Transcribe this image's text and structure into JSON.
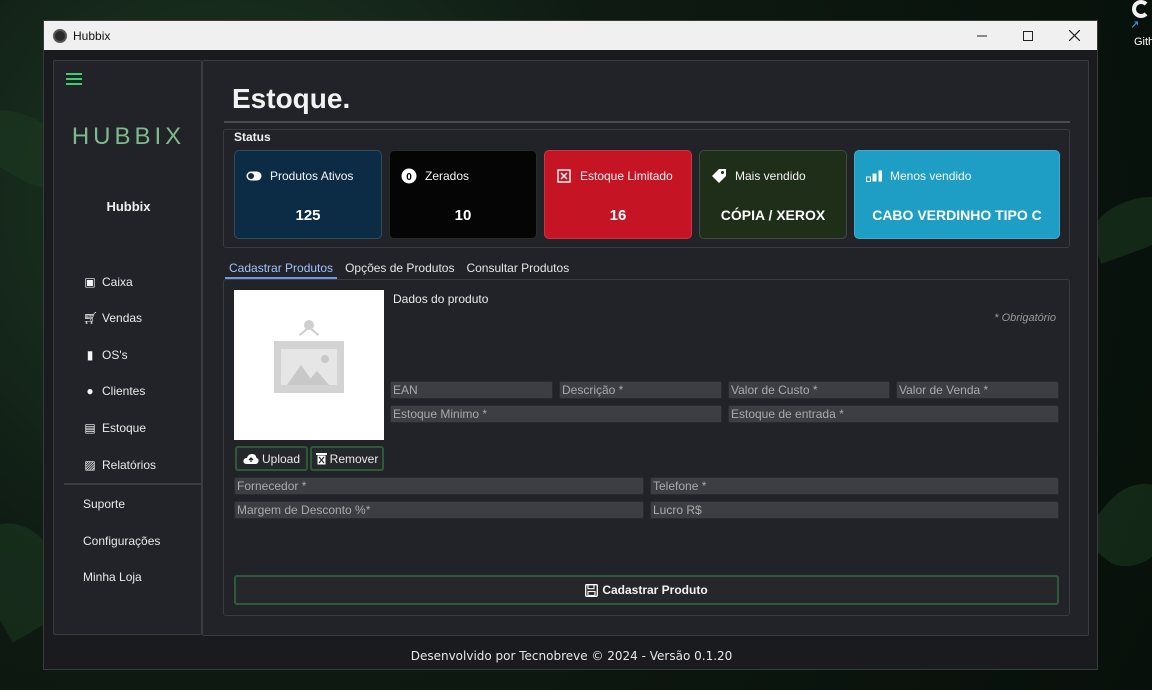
{
  "window": {
    "title": "Hubbix",
    "controls": [
      "minimize",
      "maximize",
      "close"
    ]
  },
  "desktop": {
    "shortcut_label": "Gith"
  },
  "sidebar": {
    "logo": "HUBBIX",
    "user": "Hubbix",
    "items": [
      {
        "label": "Caixa",
        "icon": "box-icon"
      },
      {
        "label": "Vendas",
        "icon": "cart-icon"
      },
      {
        "label": "OS's",
        "icon": "document-icon"
      },
      {
        "label": "Clientes",
        "icon": "user-circle-icon"
      },
      {
        "label": "Estoque",
        "icon": "inventory-icon"
      },
      {
        "label": "Relatórios",
        "icon": "report-icon"
      }
    ],
    "bottom_items": [
      "Suporte",
      "Configurações",
      "Minha Loja"
    ]
  },
  "main": {
    "title": "Estoque.",
    "status_label": "Status",
    "cards": [
      {
        "label": "Produtos Ativos",
        "value": "125",
        "icon": "toggle-icon",
        "color": "#0c2c45"
      },
      {
        "label": "Zerados",
        "value": "10",
        "icon": "zero-icon",
        "color": "#050505"
      },
      {
        "label": "Estoque Limitado",
        "value": "16",
        "icon": "x-box-icon",
        "color": "#c51424"
      },
      {
        "label": "Mais vendido",
        "value": "CÓPIA / XEROX",
        "icon": "tag-icon",
        "color": "#1e2e18"
      },
      {
        "label": "Menos vendido",
        "value": "CABO VERDINHO TIPO C",
        "icon": "signal-bars-icon",
        "color": "#1e9ec4"
      }
    ],
    "tabs": [
      "Cadastrar Produtos",
      "Opções de Produtos",
      "Consultar Produtos"
    ],
    "active_tab": "Cadastrar Produtos",
    "form": {
      "section_label": "Dados do produto",
      "required_note": "* Obrigatório",
      "upload_label": "Upload",
      "remove_label": "Remover",
      "fields": {
        "ean": "EAN",
        "descricao": "Descrição *",
        "valor_custo": "Valor de Custo *",
        "valor_venda": "Valor de Venda *",
        "estoque_minimo": "Estoque Minimo *",
        "estoque_entrada": "Estoque de entrada *",
        "fornecedor": "Fornecedor *",
        "telefone": "Telefone *",
        "margem_desconto": "Margem de Desconto %*",
        "lucro": "Lucro R$"
      },
      "submit_label": "Cadastrar Produto"
    }
  },
  "footer": "Desenvolvido por Tecnobreve © 2024 - Versão 0.1.20",
  "colors": {
    "accent": "#3ecf6a",
    "button_border": "#2e5a3a",
    "tab_active": "#9ec3ff"
  }
}
